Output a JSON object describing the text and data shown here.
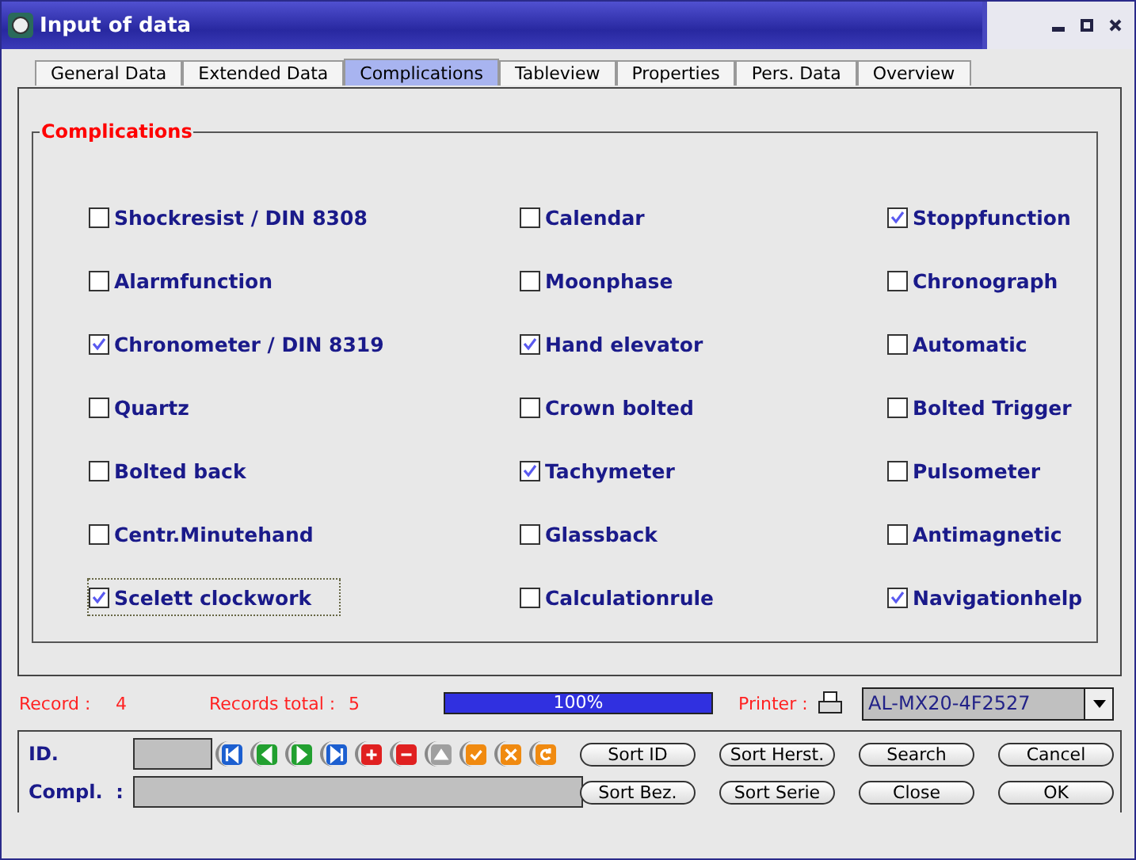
{
  "window": {
    "title": "Input of data"
  },
  "tabs": [
    {
      "label": "General Data",
      "selected": false
    },
    {
      "label": "Extended Data",
      "selected": false
    },
    {
      "label": "Complications",
      "selected": true
    },
    {
      "label": "Tableview",
      "selected": false
    },
    {
      "label": "Properties",
      "selected": false
    },
    {
      "label": "Pers. Data",
      "selected": false
    },
    {
      "label": "Overview",
      "selected": false
    }
  ],
  "group": {
    "title": "Complications"
  },
  "columns": [
    [
      {
        "label": "Shockresist / DIN 8308",
        "checked": false,
        "focused": false
      },
      {
        "label": "Alarmfunction",
        "checked": false,
        "focused": false
      },
      {
        "label": "Chronometer / DIN 8319",
        "checked": true,
        "focused": false
      },
      {
        "label": "Quartz",
        "checked": false,
        "focused": false
      },
      {
        "label": "Bolted back",
        "checked": false,
        "focused": false
      },
      {
        "label": "Centr.Minutehand",
        "checked": false,
        "focused": false
      },
      {
        "label": "Scelett clockwork",
        "checked": true,
        "focused": true
      }
    ],
    [
      {
        "label": "Calendar",
        "checked": false,
        "focused": false
      },
      {
        "label": "Moonphase",
        "checked": false,
        "focused": false
      },
      {
        "label": "Hand elevator",
        "checked": true,
        "focused": false
      },
      {
        "label": "Crown bolted",
        "checked": false,
        "focused": false
      },
      {
        "label": "Tachymeter",
        "checked": true,
        "focused": false
      },
      {
        "label": "Glassback",
        "checked": false,
        "focused": false
      },
      {
        "label": "Calculationrule",
        "checked": false,
        "focused": false
      }
    ],
    [
      {
        "label": "Stoppfunction",
        "checked": true,
        "focused": false
      },
      {
        "label": "Chronograph",
        "checked": false,
        "focused": false
      },
      {
        "label": "Automatic",
        "checked": false,
        "focused": false
      },
      {
        "label": "Bolted Trigger",
        "checked": false,
        "focused": false
      },
      {
        "label": "Pulsometer",
        "checked": false,
        "focused": false
      },
      {
        "label": "Antimagnetic",
        "checked": false,
        "focused": false
      },
      {
        "label": "Navigationhelp",
        "checked": true,
        "focused": false
      }
    ]
  ],
  "status": {
    "record_label": "Record :",
    "record": "4",
    "total_label": "Records total :",
    "total": "5",
    "progress": {
      "level": 1,
      "text": "100%"
    },
    "printer_label": "Printer :",
    "printer": "AL-MX20-4F2527"
  },
  "form": {
    "id_label": "ID.",
    "compl_label": "Compl.  :"
  },
  "buttons": [
    [
      "Sort ID",
      "Sort Herst.",
      "Search",
      "Cancel"
    ],
    [
      "Sort Bez.",
      "Sort Serie",
      "Close",
      "OK"
    ]
  ]
}
